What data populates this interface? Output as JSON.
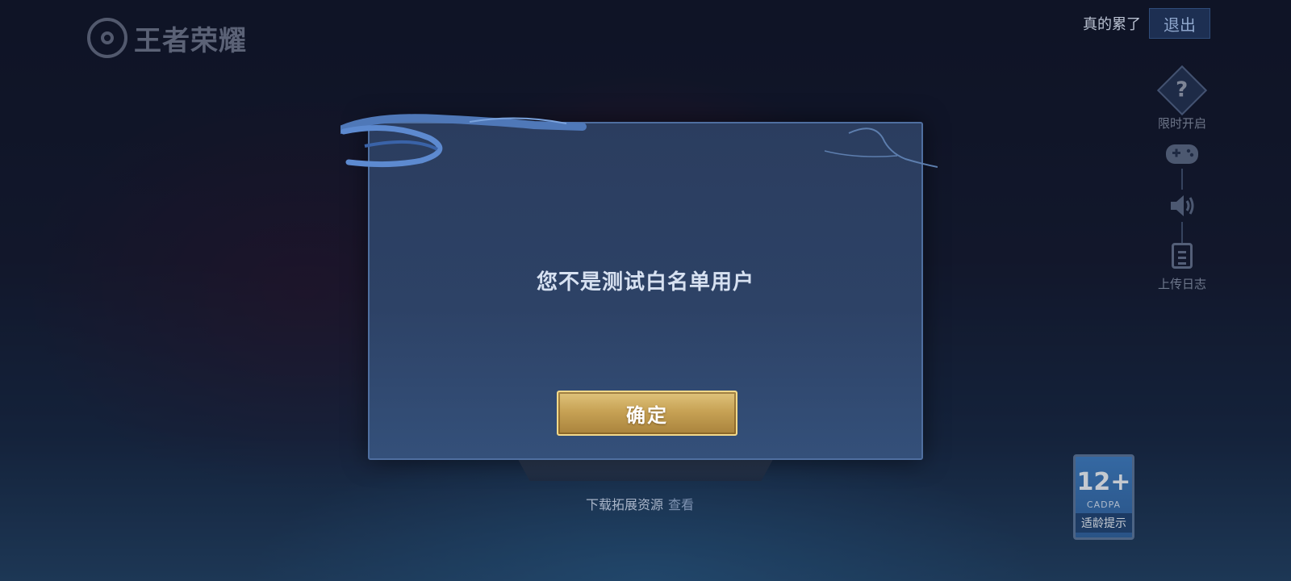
{
  "logo": {
    "text": "王者荣耀"
  },
  "top_right": {
    "status_label": "真的累了",
    "exit_label": "退出"
  },
  "side_panel": {
    "items": [
      {
        "icon": "question-icon",
        "glyph": "?",
        "label": "限时开启"
      },
      {
        "icon": "gamepad-icon",
        "label": ""
      },
      {
        "icon": "speaker-icon",
        "label": ""
      },
      {
        "icon": "clipboard-icon",
        "label": "上传日志"
      }
    ]
  },
  "dialog": {
    "message": "您不是测试白名单用户",
    "confirm_label": "确定"
  },
  "download": {
    "label": "下载拓展资源",
    "link": "查看"
  },
  "age_badge": {
    "rating": "12+",
    "org": "CADPA",
    "tip": "适龄提示"
  },
  "colors": {
    "confirm_gold": "#c7a255",
    "dialog_bg": "#2d4266",
    "dialog_border": "#4f6fa0"
  }
}
